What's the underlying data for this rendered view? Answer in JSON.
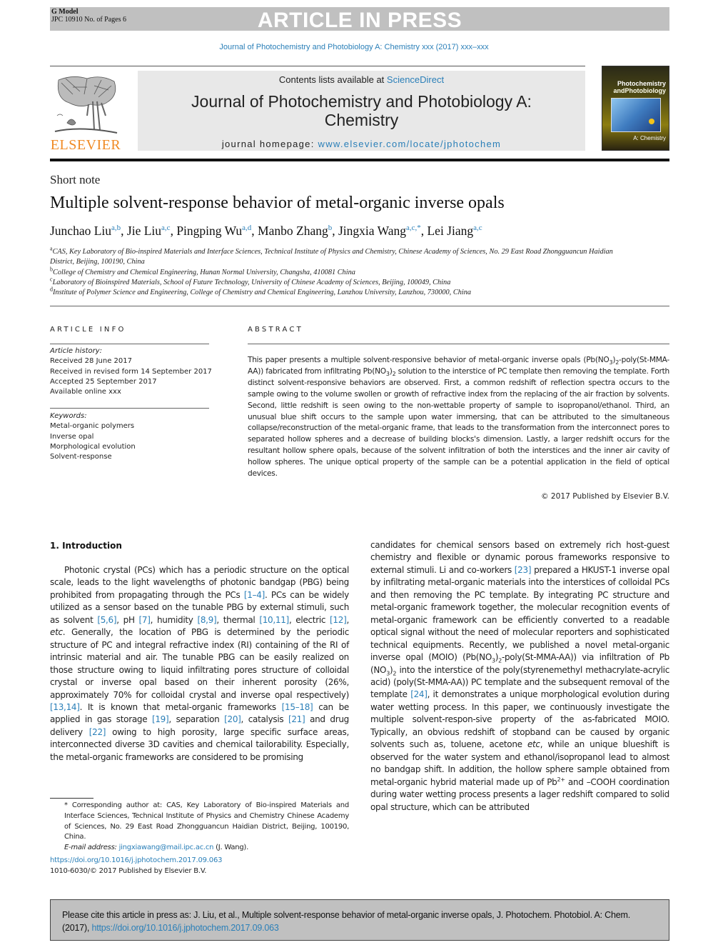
{
  "header": {
    "g_model": "G Model",
    "pages_info": "JPC 10910 No. of Pages 6",
    "banner": "ARTICLE IN PRESS",
    "journal_ref": "Journal of Photochemistry and Photobiology A: Chemistry xxx (2017) xxx–xxx",
    "contents_prefix": "Contents lists available at ",
    "contents_link": "ScienceDirect",
    "journal_title_line1": "Journal of Photochemistry and Photobiology A:",
    "journal_title_line2": "Chemistry",
    "homepage_prefix": "journal homepage: ",
    "homepage_link": "www.elsevier.com/locate/jphotochem",
    "publisher_logo_text": "ELSEVIER",
    "cover": {
      "title1": "Photochemistry",
      "title2": "andPhotobiology",
      "section": "A: Chemistry"
    }
  },
  "article": {
    "type": "Short note",
    "title": "Multiple solvent-response behavior of metal-organic inverse opals",
    "authors": [
      {
        "name": "Junchao Liu",
        "aff": "a,b",
        "sep": ", "
      },
      {
        "name": "Jie Liu",
        "aff": "a,c",
        "sep": ", "
      },
      {
        "name": "Pingping Wu",
        "aff": "a,d",
        "sep": ", "
      },
      {
        "name": "Manbo Zhang",
        "aff": "b",
        "sep": ", "
      },
      {
        "name": "Jingxia Wang",
        "aff": "a,c,*",
        "sep": ", "
      },
      {
        "name": "Lei Jiang",
        "aff": "a,c",
        "sep": ""
      }
    ],
    "affiliations": [
      {
        "key": "a",
        "text": "CAS, Key Laboratory of Bio-inspired Materials and Interface Sciences, Technical Institute of Physics and Chemistry, Chinese Academy of Sciences, No. 29 East Road Zhongguancun Haidian District, Beijing, 100190, China"
      },
      {
        "key": "b",
        "text": "College of Chemistry and Chemical Engineering, Hunan Normal University, Changsha, 410081 China"
      },
      {
        "key": "c",
        "text": "Laboratory of Bioinspired Materials, School of Future Technology, University of Chinese Academy of Sciences, Beijing, 100049, China"
      },
      {
        "key": "d",
        "text": "Institute of Polymer Science and Engineering, College of Chemistry and Chemical Engineering, Lanzhou University, Lanzhou, 730000, China"
      }
    ]
  },
  "article_info": {
    "heading": "ARTICLE INFO",
    "history_label": "Article history:",
    "history": [
      "Received 28 June 2017",
      "Received in revised form 14 September 2017",
      "Accepted 25 September 2017",
      "Available online xxx"
    ],
    "keywords_label": "Keywords:",
    "keywords": [
      "Metal-organic polymers",
      "Inverse opal",
      "Morphological evolution",
      "Solvent-response"
    ]
  },
  "abstract": {
    "heading": "ABSTRACT",
    "p1": "This paper presents a multiple solvent-responsive behavior of metal-organic inverse opals (Pb(NO",
    "p2": ")",
    "p3": "-poly(St-MMA-AA)) fabricated from infiltrating Pb(NO",
    "p4": ")",
    "p5": " solution to the interstice of PC template then removing the template. Forth distinct solvent-responsive behaviors are observed. First, a common redshift of reflection spectra occurs to the sample owing to the volume swollen or growth of refractive index from the replacing of the air fraction by solvents. Second, little redshift is seen owing to the non-wettable property of sample to isopropanol/ethanol. Third, an unusual blue shift occurs to the sample upon water immersing, that can be attributed to the simultaneous collapse/reconstruction of the metal-organic frame, that leads to the transformation from the interconnect pores to separated hollow spheres and a decrease of building blocks's dimension. Lastly, a larger redshift occurs for the resultant hollow sphere opals, because of the solvent infiltration of both the interstices and the inner air cavity of hollow spheres. The unique optical property of the sample can be a potential application in the field of optical devices.",
    "sub3": "3",
    "sub2": "2",
    "copyright": "© 2017 Published by Elsevier B.V."
  },
  "introduction": {
    "heading": "1. Introduction",
    "left": [
      {
        "t": "Photonic crystal (PCs) which has a periodic structure on the optical scale, leads to the light wavelengths of photonic bandgap (PBG) being prohibited from propagating through the PCs "
      },
      {
        "ref": "[1–4]"
      },
      {
        "t": ". PCs can be widely utilized as a sensor based on the tunable PBG by external stimuli, such as solvent "
      },
      {
        "ref": "[5,6]"
      },
      {
        "t": ", pH "
      },
      {
        "ref": "[7]"
      },
      {
        "t": ", humidity "
      },
      {
        "ref": "[8,9]"
      },
      {
        "t": ", thermal "
      },
      {
        "ref": "[10,11]"
      },
      {
        "t": ", electric "
      },
      {
        "ref": "[12]"
      },
      {
        "t": ", "
      },
      {
        "i": "etc"
      },
      {
        "t": ". Generally, the location of PBG is determined by the periodic structure of PC and integral refractive index (RI) containing of the RI of intrinsic material and air. The tunable PBG can be easily realized on those structure owing to liquid infiltrating pores structure of colloidal crystal or inverse opal based on their inherent porosity (26%, approximately 70% for colloidal crystal and inverse opal respectively) "
      },
      {
        "ref": "[13,14]"
      },
      {
        "t": ". It is known that metal-organic frameworks "
      },
      {
        "ref": "[15–18]"
      },
      {
        "t": " can be applied in gas storage "
      },
      {
        "ref": "[19]"
      },
      {
        "t": ", separation "
      },
      {
        "ref": "[20]"
      },
      {
        "t": ", catalysis "
      },
      {
        "ref": "[21]"
      },
      {
        "t": " and drug delivery "
      },
      {
        "ref": "[22]"
      },
      {
        "t": " owing to high porosity, large specific surface areas, interconnected diverse 3D cavities and chemical tailorability. Especially, the metal-organic frameworks are considered to be promising"
      }
    ],
    "right": [
      {
        "t": "candidates for chemical sensors based on extremely rich host-guest chemistry and flexible or dynamic porous frameworks responsive to external stimuli. Li and co-workers "
      },
      {
        "ref": "[23]"
      },
      {
        "t": " prepared a HKUST-1 inverse opal by infiltrating metal-organic materials into the interstices of colloidal PCs and then removing the PC template. By integrating PC structure and metal-organic framework together, the molecular recognition events of metal-organic framework can be efficiently converted to a readable optical signal without the need of molecular reporters and sophisticated technical equipments. Recently, we published a novel metal-organic inverse opal (MOIO) (Pb(NO"
      },
      {
        "sub": "3"
      },
      {
        "t": ")"
      },
      {
        "sub": "2"
      },
      {
        "t": "-poly(St-MMA-AA)) via infiltration of Pb (NO"
      },
      {
        "sub": "3"
      },
      {
        "t": ")"
      },
      {
        "sub": "2"
      },
      {
        "t": " into the interstice of the poly(styrenemethyl methacrylate-acrylic acid) (poly(St-MMA-AA)) PC template and the subsequent removal of the template "
      },
      {
        "ref": "[24]"
      },
      {
        "t": ", it demonstrates a unique morphological evolution during water wetting process. In this paper, we continuously investigate the multiple solvent-respon-sive property of the as-fabricated MOIO. Typically, an obvious redshift of stopband can be caused by organic solvents such as, toluene, acetone "
      },
      {
        "i": "etc"
      },
      {
        "t": ", while an unique blueshift is observed for the water system and ethanol/isopropanol lead to almost no bandgap shift. In addition, the hollow sphere sample obtained from metal-organic hybrid material made up of Pb"
      },
      {
        "sup": "2+"
      },
      {
        "t": " and –COOH coordination during water wetting process presents a lager redshift compared to solid opal structure, which can be attributed"
      }
    ]
  },
  "footnote": {
    "corresponding": "* Corresponding author at: CAS, Key Laboratory of Bio-inspired Materials and Interface Sciences, Technical Institute of Physics and Chemistry Chinese Academy of Sciences, No. 29 East Road Zhongguancun Haidian District, Beijing, 100190, China.",
    "email_label": "E-mail address:",
    "email": "jingxiawang@mail.ipc.ac.cn",
    "email_suffix": " (J. Wang).",
    "doi": "https://doi.org/10.1016/j.jphotochem.2017.09.063",
    "issn": "1010-6030/© 2017 Published by Elsevier B.V."
  },
  "citation_box": {
    "text": "Please cite this article in press as: J. Liu, et al., Multiple solvent-response behavior of metal-organic inverse opals, J. Photochem. Photobiol. A: Chem. (2017), ",
    "doi": "https://doi.org/10.1016/j.jphotochem.2017.09.063"
  }
}
